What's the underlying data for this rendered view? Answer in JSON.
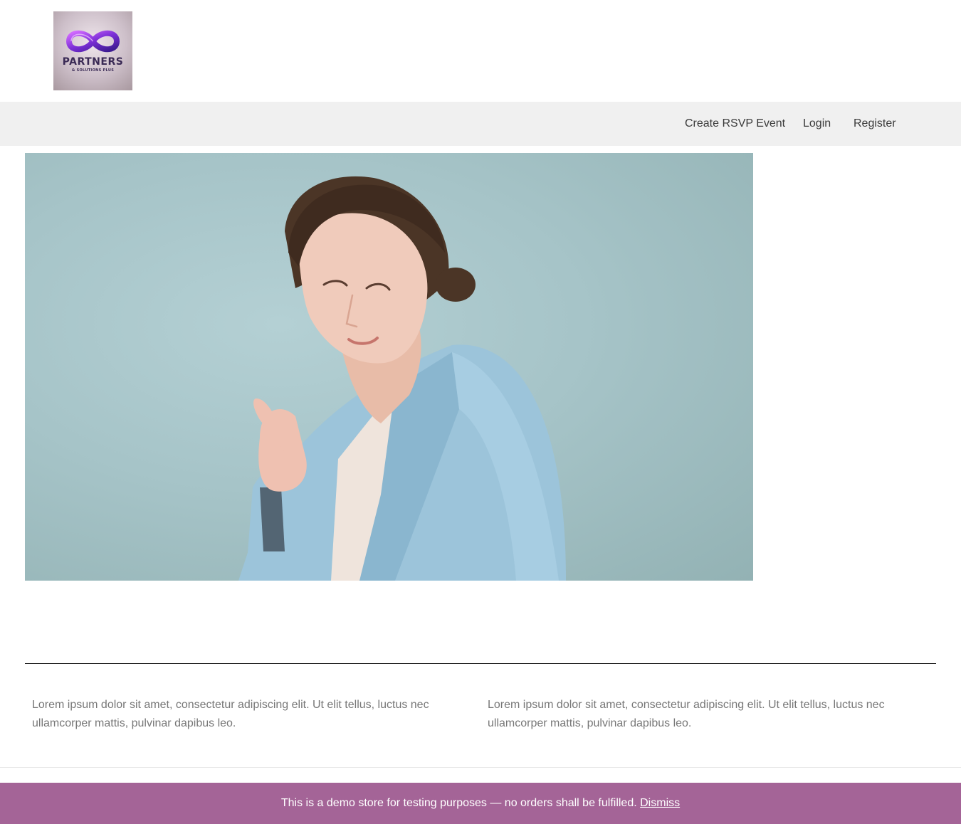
{
  "logo": {
    "word": "PARTNERS",
    "tagline": "& SOLUTIONS PLUS",
    "icon": "infinity-icon"
  },
  "nav": {
    "items": [
      {
        "label": "Create RSVP Event"
      },
      {
        "label": "Login"
      },
      {
        "label": "Register"
      }
    ]
  },
  "content": {
    "columns": [
      {
        "text": "Lorem ipsum dolor sit amet, consectetur adipiscing elit. Ut elit tellus, luctus nec ullamcorper mattis, pulvinar dapibus leo."
      },
      {
        "text": "Lorem ipsum dolor sit amet, consectetur adipiscing elit. Ut elit tellus, luctus nec ullamcorper mattis, pulvinar dapibus leo."
      }
    ]
  },
  "notice": {
    "text": "This is a demo store for testing purposes — no orders shall be fulfilled.",
    "dismiss_label": "Dismiss",
    "background": "#a46497"
  },
  "colors": {
    "nav_background": "#f0f0f0",
    "nav_text": "#3a3a3a",
    "body_text": "#777777",
    "hero_background": "#a6c4c8"
  }
}
